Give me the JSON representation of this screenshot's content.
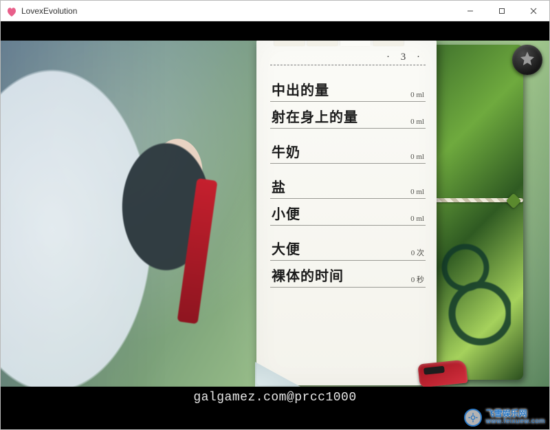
{
  "window": {
    "title": "LovexEvolution"
  },
  "toolbar": {
    "star_label": "favorite"
  },
  "notebook": {
    "page_number": "· 3 ·",
    "tabs": [
      {
        "active": false
      },
      {
        "active": false
      },
      {
        "active": true
      },
      {
        "active": false
      }
    ],
    "rows": [
      {
        "label": "中出的量",
        "value": "0 ml",
        "spaced": false
      },
      {
        "label": "射在身上的量",
        "value": "0 ml",
        "spaced": false
      },
      {
        "label": "牛奶",
        "value": "0 ml",
        "spaced": true
      },
      {
        "label": "盐",
        "value": "0 ml",
        "spaced": true
      },
      {
        "label": "小便",
        "value": "0 ml",
        "spaced": false
      },
      {
        "label": "大便",
        "value": "0 次",
        "spaced": true
      },
      {
        "label": "裸体的时间",
        "value": "0 秒",
        "spaced": false
      }
    ]
  },
  "footer": {
    "text": "galgamez.com@prcc1000"
  },
  "watermark": {
    "line1": "飞雪娱乐网",
    "line2": "www.feixuew.com"
  }
}
